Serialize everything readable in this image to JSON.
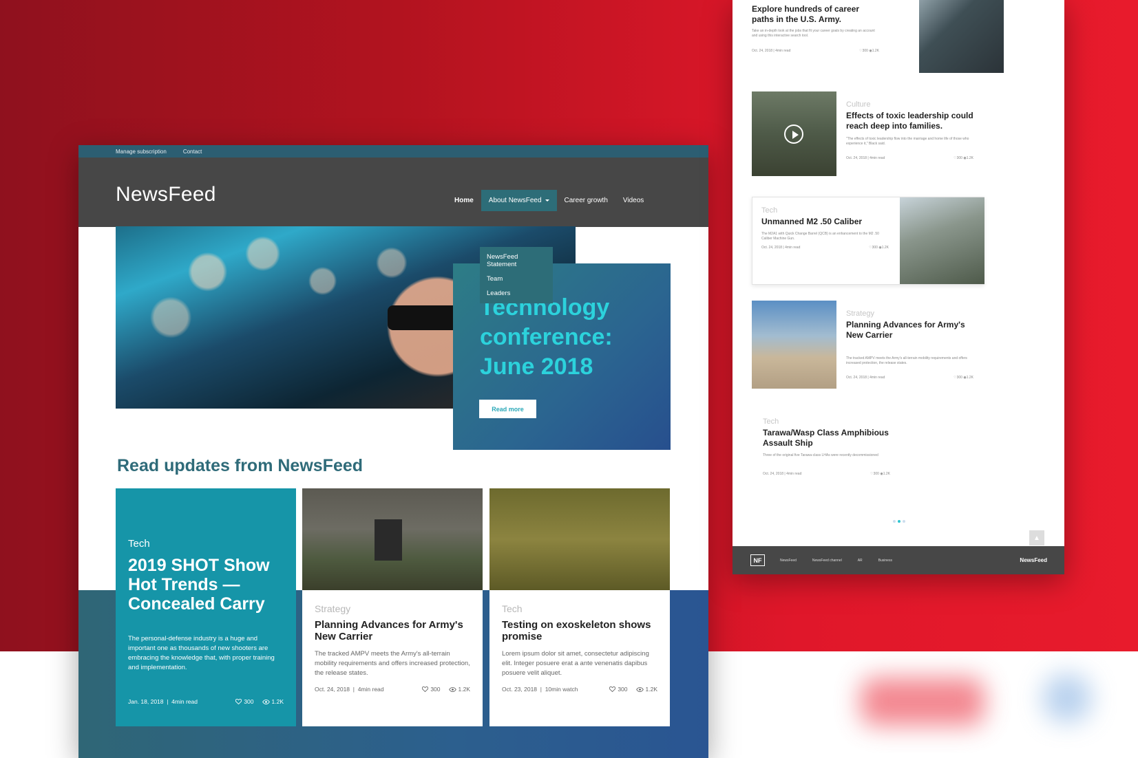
{
  "site": {
    "topbar": [
      "Manage subscription",
      "Contact"
    ],
    "logo": "NewsFeed",
    "nav": {
      "home": "Home",
      "about": "About NewsFeed",
      "career": "Career growth",
      "videos": "Videos"
    },
    "dropdown": [
      "NewsFeed Statement",
      "Team",
      "Leaders"
    ],
    "hero": {
      "title": "Technology conference: June 2018",
      "button": "Read more"
    },
    "updates_title": "Read updates from NewsFeed",
    "cards": [
      {
        "category": "Tech",
        "title": "2019 SHOT Show Hot Trends — Concealed Carry",
        "desc": "The personal-defense industry is a huge and important one as thousands of new shooters are embracing the knowledge that, with proper training and implementation.",
        "date": "Jan. 18, 2018",
        "read": "4min read",
        "likes": "300",
        "views": "1.2K"
      },
      {
        "category": "Strategy",
        "title": "Planning Advances for Army's New Carrier",
        "desc": "The tracked AMPV meets the Army's all-terrain mobility requirements and offers increased protection, the release states.",
        "date": "Oct. 24, 2018",
        "read": "4min read",
        "likes": "300",
        "views": "1.2K"
      },
      {
        "category": "Tech",
        "title": "Testing on exoskeleton shows promise",
        "desc": "Lorem ipsum dolor sit amet, consectetur adipiscing elit. Integer posuere erat a ante venenatis dapibus posuere velit aliquet.",
        "date": "Oct. 23, 2018",
        "read": "10min watch",
        "likes": "300",
        "views": "1.2K"
      }
    ]
  },
  "panel": {
    "articles": [
      {
        "category": "",
        "title": "Explore hundreds of career paths in the U.S. Army.",
        "desc": "Take an in-depth look at the jobs that fit your career goals by creating an account and using this interactive search tool.",
        "date": "Oct. 24, 2018",
        "read": "4min read",
        "likes": "300",
        "views": "1.2K"
      },
      {
        "category": "Culture",
        "title": "Effects of toxic leadership could reach deep into families.",
        "desc": "\"The effects of toxic leadership flow into the marriage and home life of those who experience it,\" Black said.",
        "date": "Oct. 24, 2018",
        "read": "4min read",
        "likes": "300",
        "views": "1.2K"
      },
      {
        "category": "Tech",
        "title": "Unmanned M2 .50 Caliber",
        "desc": "The M2A1 with Quick Change Barrel (QCB) is an enhancement to the M2 .50 Caliber Machine Gun.",
        "date": "Oct. 24, 2018",
        "read": "4min read",
        "likes": "300",
        "views": "1.2K"
      },
      {
        "category": "Strategy",
        "title": "Planning Advances for Army's New Carrier",
        "desc": "The tracked AMPV meets the Army's all-terrain mobility requirements and offers increased protection, the release states.",
        "date": "Oct. 24, 2018",
        "read": "4min read",
        "likes": "300",
        "views": "1.2K"
      },
      {
        "category": "Tech",
        "title": "Tarawa/Wasp Class Amphibious Assault Ship",
        "desc": "Three of the original five Tarawa-class LHAs were recently decommissioned",
        "date": "Oct. 24, 2018",
        "read": "4min read",
        "likes": "300",
        "views": "1.2K"
      }
    ],
    "footer": {
      "logo": "NF",
      "links": [
        "NewsFeed",
        "NewsFeed channel",
        "AR",
        "Business"
      ],
      "brand": "NewsFeed"
    }
  },
  "colors": {
    "red": "#e0172a",
    "teal": "#1695a8",
    "header": "#474747",
    "accent": "#2cd2dc"
  }
}
